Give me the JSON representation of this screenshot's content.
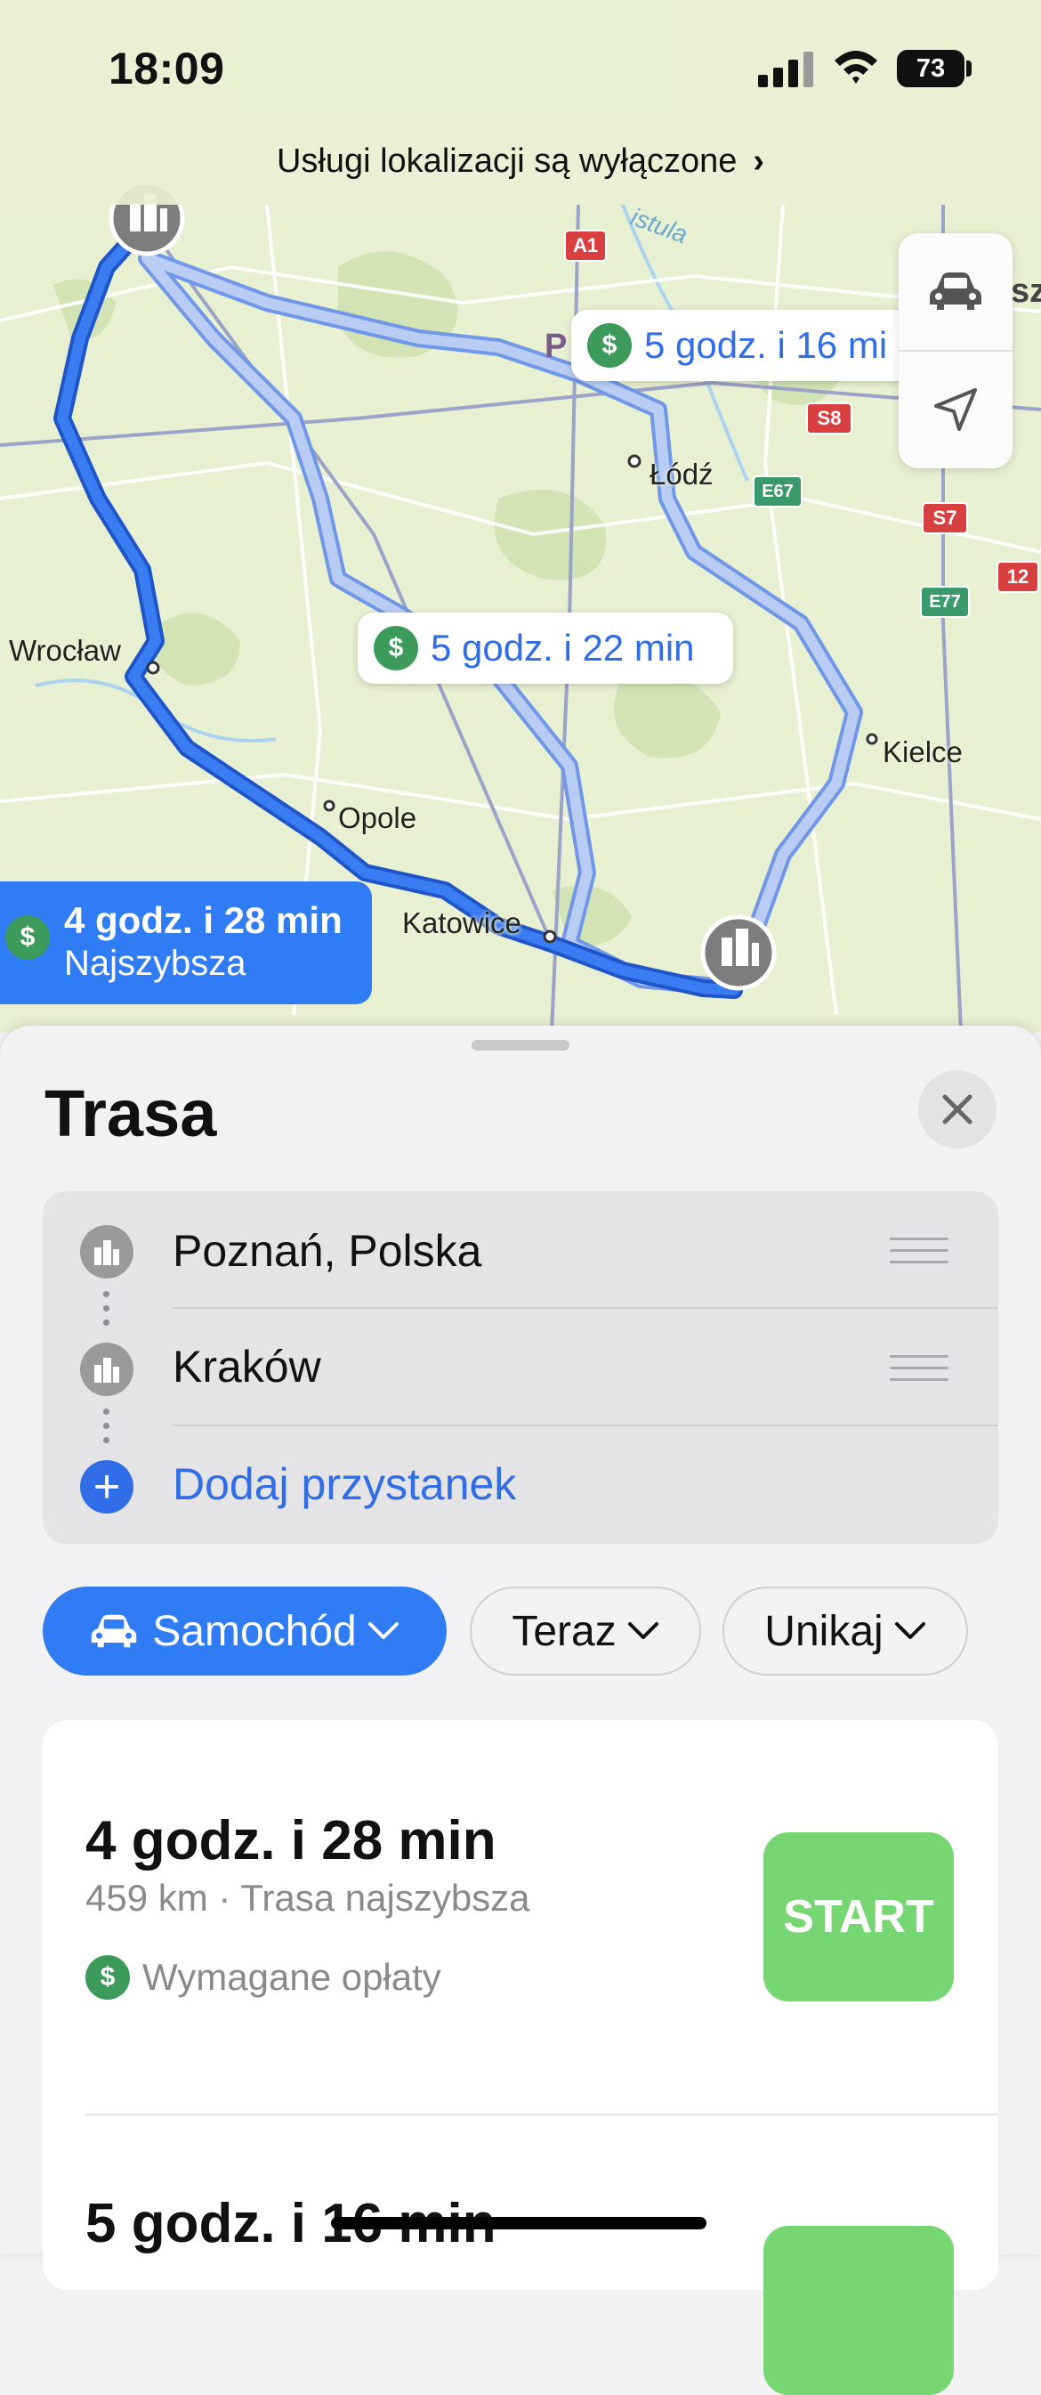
{
  "status_bar": {
    "time": "18:09",
    "battery": "73"
  },
  "location_banner": {
    "text": "Usługi lokalizacji są wyłączone",
    "chevron": "›"
  },
  "map": {
    "road_labels": [
      "A1",
      "S8",
      "E67",
      "S7",
      "E77",
      "12"
    ],
    "cities": [
      "Łódź",
      "Wrocław",
      "Opole",
      "Katowice",
      "Kielce"
    ],
    "river_label": "istula",
    "partial_labels": [
      "P",
      "sz"
    ],
    "route_bubbles": [
      {
        "time": "5 godz. i 16 mi",
        "toll_icon": "$"
      },
      {
        "time": "5 godz. i 22 min",
        "toll_icon": "$"
      }
    ],
    "fastest_bubble": {
      "time": "4 godz. i 28 min",
      "label": "Najszybsza",
      "toll_icon": "$"
    },
    "controls": [
      "car-icon",
      "location-arrow-icon"
    ]
  },
  "sheet": {
    "title": "Trasa",
    "stops": [
      {
        "label": "Poznań, Polska",
        "icon": "city-icon"
      },
      {
        "label": "Kraków",
        "icon": "city-icon"
      }
    ],
    "add_stop": {
      "label": "Dodaj przystanek",
      "icon": "+"
    },
    "filters": {
      "transport": "Samochód",
      "when": "Teraz",
      "avoid": "Unikaj"
    },
    "routes": [
      {
        "time": "4 godz. i 28 min",
        "meta": "459 km · Trasa najszybsza",
        "toll": "Wymagane opłaty",
        "toll_icon": "$",
        "start": "START"
      },
      {
        "time": "5 godz. i 16 min"
      }
    ]
  },
  "colors": {
    "accent_blue": "#2f7cf4",
    "start_green": "#76d672",
    "toll_green": "#3c9b5a",
    "map_land": "#e8f0d2"
  }
}
